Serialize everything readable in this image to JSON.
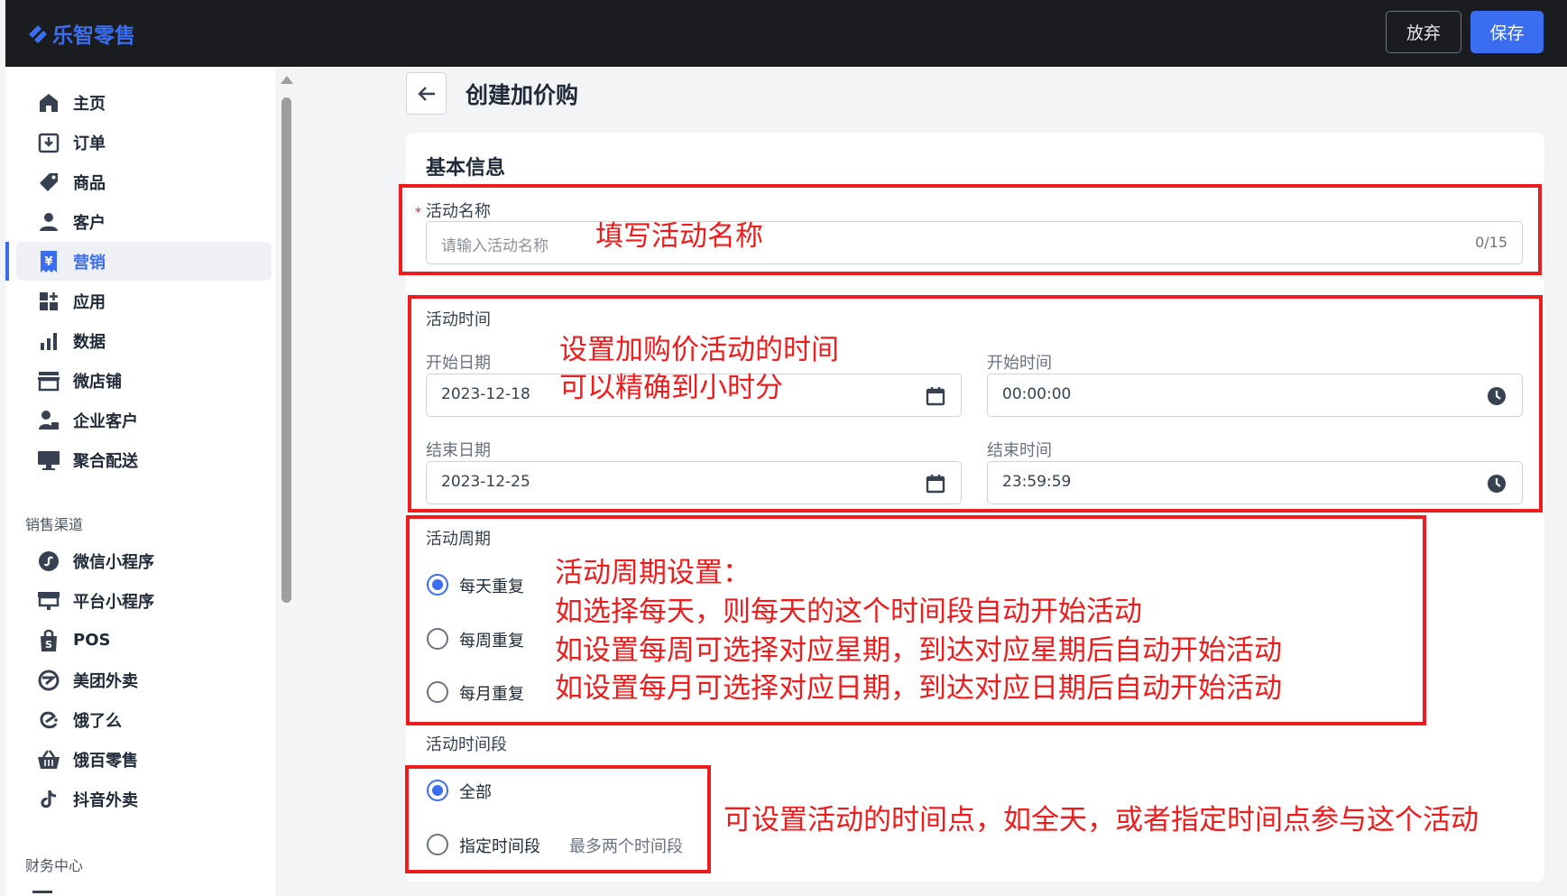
{
  "app": {
    "name": "乐智零售",
    "brand_color": "#3b6df0",
    "discard_label": "放弃",
    "save_label": "保存"
  },
  "sidebar": {
    "items": [
      {
        "label": "主页",
        "icon": "home-icon"
      },
      {
        "label": "订单",
        "icon": "order-download-icon"
      },
      {
        "label": "商品",
        "icon": "tag-icon"
      },
      {
        "label": "客户",
        "icon": "person-icon"
      },
      {
        "label": "营销",
        "icon": "yen-ticket-icon",
        "active": true
      },
      {
        "label": "应用",
        "icon": "apps-grid-icon"
      },
      {
        "label": "数据",
        "icon": "bar-chart-icon"
      },
      {
        "label": "微店铺",
        "icon": "storefront-icon"
      },
      {
        "label": "企业客户",
        "icon": "business-person-icon"
      },
      {
        "label": "聚合配送",
        "icon": "monitor-icon"
      }
    ],
    "channels_title": "销售渠道",
    "channels": [
      {
        "label": "微信小程序",
        "icon": "mini-program-icon"
      },
      {
        "label": "平台小程序",
        "icon": "platform-icon"
      },
      {
        "label": "POS",
        "icon": "shopping-bag-icon"
      },
      {
        "label": "美团外卖",
        "icon": "meituan-icon"
      },
      {
        "label": "饿了么",
        "icon": "eleme-icon"
      },
      {
        "label": "饿百零售",
        "icon": "basket-icon"
      },
      {
        "label": "抖音外卖",
        "icon": "tiktok-icon"
      }
    ],
    "finance_title": "财务中心"
  },
  "page": {
    "title": "创建加价购",
    "section_title": "基本信息",
    "activity_name": {
      "label": "活动名称",
      "placeholder": "请输入活动名称",
      "count": "0/15"
    },
    "activity_time": {
      "label": "活动时间",
      "start_date_label": "开始日期",
      "start_date": "2023-12-18",
      "start_time_label": "开始时间",
      "start_time": "00:00:00",
      "end_date_label": "结束日期",
      "end_date": "2023-12-25",
      "end_time_label": "结束时间",
      "end_time": "23:59:59"
    },
    "cycle": {
      "label": "活动周期",
      "options": [
        "每天重复",
        "每周重复",
        "每月重复"
      ],
      "selected": 0
    },
    "period": {
      "label": "活动时间段",
      "options": [
        "全部",
        "指定时间段"
      ],
      "selected": 0,
      "hint": "最多两个时间段"
    }
  },
  "annotations": {
    "color": "#ee1c1c",
    "name_note": "填写活动名称",
    "time_note_1": "设置加购价活动的时间",
    "time_note_2": "可以精确到小时分",
    "cycle_note_1": "活动周期设置：",
    "cycle_note_2": "如选择每天，则每天的这个时间段自动开始活动",
    "cycle_note_3": "如设置每周可选择对应星期，到达对应星期后自动开始活动",
    "cycle_note_4": "如设置每月可选择对应日期，到达对应日期后自动开始活动",
    "period_note": "可设置活动的时间点，如全天，或者指定时间点参与这个活动"
  }
}
